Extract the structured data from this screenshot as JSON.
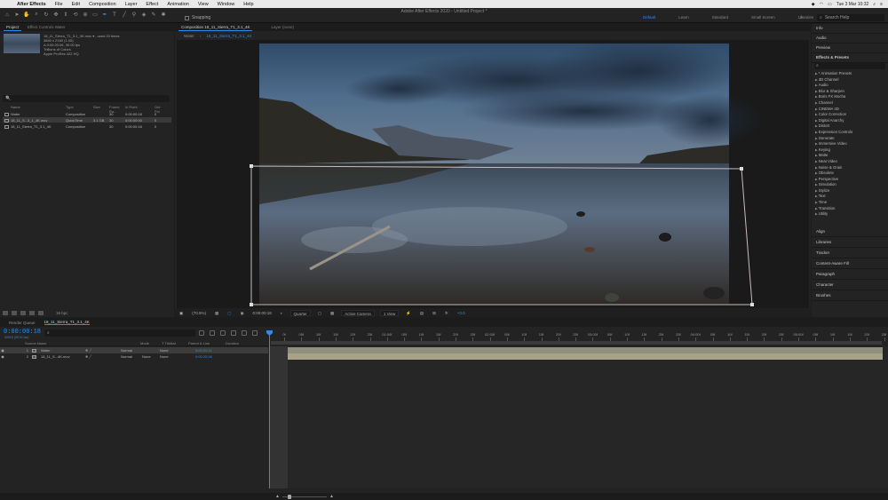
{
  "menubar": {
    "apple": "",
    "app": "After Effects",
    "items": [
      "File",
      "Edit",
      "Composition",
      "Layer",
      "Effect",
      "Animation",
      "View",
      "Window",
      "Help"
    ],
    "datetime": "Tue 3 Mar  10:32"
  },
  "window": {
    "title": "Adobe After Effects 2020 - Untitled Project *"
  },
  "toolbar": {
    "snapping": "Snapping",
    "workspaces": [
      "Default",
      "Learn",
      "Standard",
      "Small Screen",
      "Libraries"
    ],
    "active_workspace": "Default",
    "more": "»",
    "search_placeholder": "Search Help"
  },
  "project": {
    "tabs": [
      "Project",
      "Effect Controls Water"
    ],
    "selected_item": {
      "name": "18_11_Sierra_T1_3.1_4K.mov ▾ , used 20 times",
      "details": [
        "3840 x 2160 (1.00)",
        "Δ 0:00:20:06, 30.00 fps",
        "Trillions of Colors",
        "Apple ProRes 422 HQ"
      ]
    },
    "search_icon": "🔍",
    "columns": [
      "Name",
      "Type",
      "Size",
      "Frame Ra...",
      "In Point",
      "Out Poi"
    ],
    "rows": [
      {
        "name": "Water",
        "type": "Composition",
        "size": "",
        "rate": "30",
        "in": "0:00:00:18",
        "out": "0"
      },
      {
        "name": "18_11_S...3_1_4K.mov",
        "type": "QuickTime",
        "size": "3.1 GB",
        "rate": "30",
        "in": "0:00:00:00",
        "out": "0"
      },
      {
        "name": "18_11_Sierra_T1_3.1_4K",
        "type": "Composition",
        "size": "",
        "rate": "30",
        "in": "0:00:00:18",
        "out": "0"
      }
    ],
    "footer_bpc": "16 bpc"
  },
  "composition": {
    "tabs": [
      "Composition 18_11_Sierra_T1_3.1_4K",
      "Layer (none)"
    ],
    "breadcrumb": [
      "Water",
      "18_11_Sierra_T1_3.1_4K"
    ],
    "footer": {
      "zoom": "(70.5%)",
      "timecode": "0:00:00:18",
      "resolution": "Quarter",
      "camera": "Active Camera",
      "views": "1 View",
      "exposure": "+0.0"
    }
  },
  "right_panel": {
    "sections_top": [
      "Info",
      "Audio",
      "Preview"
    ],
    "effects_title": "Effects & Presets",
    "effects": [
      "* Animation Presets",
      "3D Channel",
      "Audio",
      "Blur & Sharpen",
      "Boris FX Mocha",
      "Channel",
      "CINEMA 4D",
      "Color Correction",
      "Digital Anarchy",
      "Distort",
      "Expression Controls",
      "Generate",
      "Immersive Video",
      "Keying",
      "Matte",
      "Neat Video",
      "Noise & Grain",
      "Obsolete",
      "Perspective",
      "Simulation",
      "Stylize",
      "Text",
      "Time",
      "Transition",
      "Utility"
    ],
    "sections_bottom": [
      "Align",
      "Libraries",
      "Tracker",
      "Content-Aware Fill",
      "Paragraph",
      "Character",
      "Brushes"
    ]
  },
  "timeline": {
    "tabs": [
      "Render Queue",
      "18_11_Sierra_T1_3.1_4K"
    ],
    "timecode": "0:00:00:18",
    "fps": "00018 (30.00 fps)",
    "columns": [
      "Source Name",
      "Mode",
      "T TrkMat",
      "Parent & Link",
      "Duration"
    ],
    "ruler": [
      "0f",
      "05f",
      "10f",
      "15f",
      "20f",
      "25f",
      "01:00f",
      "05f",
      "10f",
      "15f",
      "20f",
      "25f",
      "02:00f",
      "05f",
      "10f",
      "15f",
      "20f",
      "25f",
      "03:00f",
      "05f",
      "10f",
      "15f",
      "20f",
      "25f",
      "04:00f",
      "05f",
      "10f",
      "15f",
      "20f",
      "25f",
      "05:00f",
      "05f",
      "10f",
      "15f",
      "20f",
      "25f"
    ],
    "layers": [
      {
        "num": "1",
        "name": "Water",
        "mode": "Normal",
        "trkmat": "",
        "parent": "None",
        "duration": "0:00:20:11",
        "bar_color": "#8f8f7b"
      },
      {
        "num": "2",
        "name": "18_11_S...4K.mov",
        "mode": "Normal",
        "trkmat": "None",
        "parent": "None",
        "duration": "0:00:20:06",
        "bar_color": "#a8a288"
      }
    ]
  },
  "colors": {
    "accent": "#2d8ceb",
    "panel_bg": "#232323"
  }
}
